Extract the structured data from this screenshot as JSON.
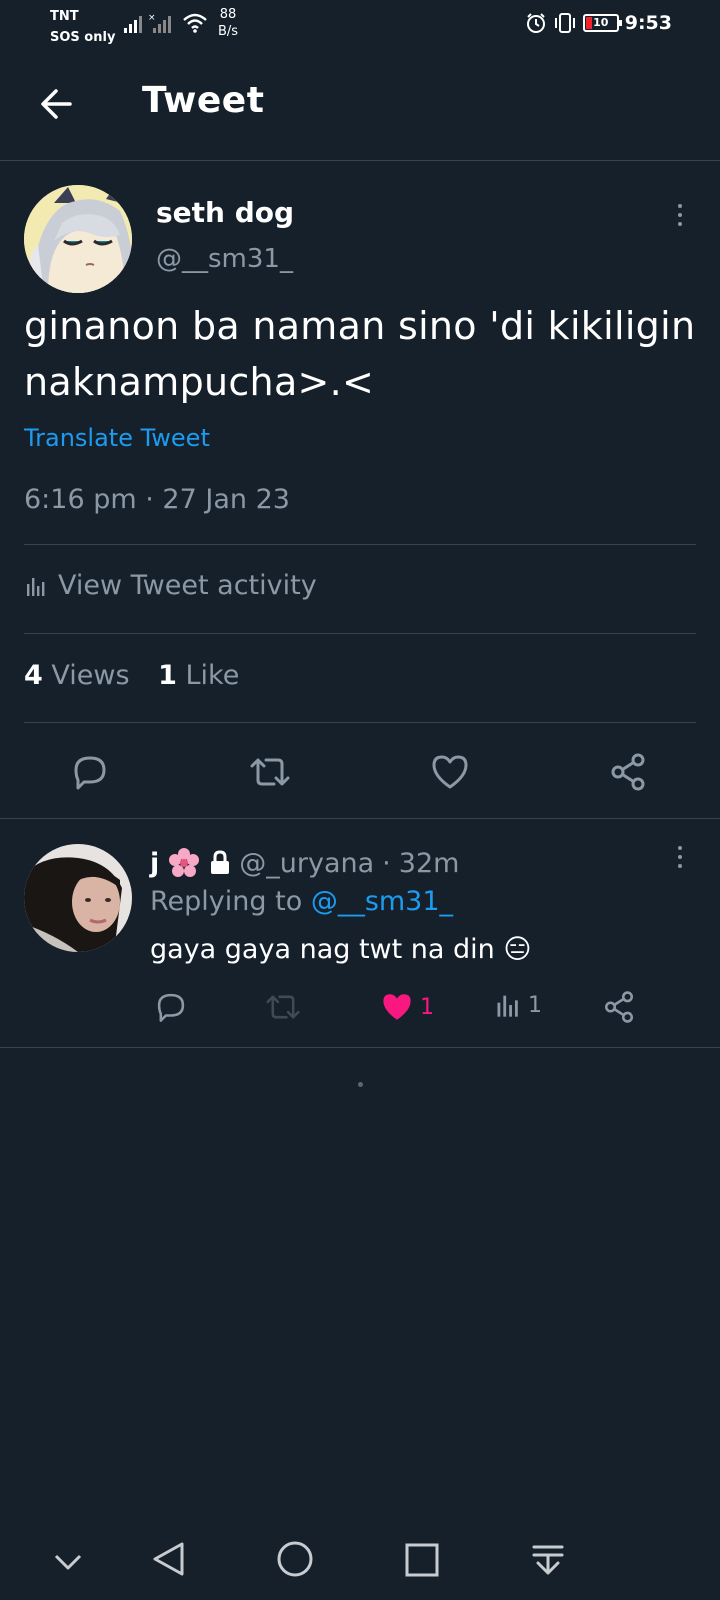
{
  "status_bar": {
    "carrier": "TNT",
    "sos": "SOS only",
    "speed_value": "88",
    "speed_unit": "B/s",
    "battery": "10",
    "time": "9:53"
  },
  "header": {
    "title": "Tweet"
  },
  "tweet": {
    "display_name": "seth dog",
    "handle": "@__sm31_",
    "text_line1": "ginanon ba naman sino 'di kikiligin",
    "text_line2": "naknampucha>.<",
    "translate": "Translate Tweet",
    "time": "6:16 pm",
    "date": "27 Jan 23",
    "activity": "View Tweet activity",
    "views_count": "4",
    "views_label": "Views",
    "likes_count": "1",
    "likes_label": "Like"
  },
  "reply": {
    "display_name": "j",
    "handle": "@_uryana",
    "age": "32m",
    "replying_prefix": "Replying to",
    "replying_handle": "@__sm31_",
    "text": "gaya gaya nag twt na din 😑",
    "likes": "1",
    "views": "1"
  },
  "colors": {
    "background": "#15202b",
    "accent": "#1d9bf0",
    "like": "#f91880",
    "muted": "#8b98a5"
  }
}
